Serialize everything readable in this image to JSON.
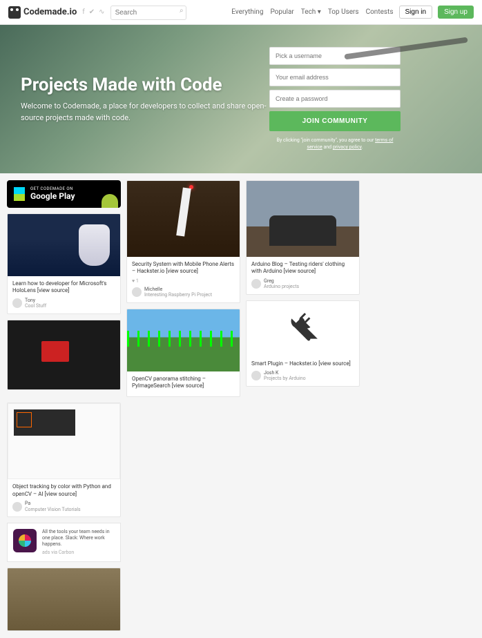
{
  "header": {
    "brand": "Codemade.io",
    "search_placeholder": "Search",
    "nav": {
      "everything": "Everything",
      "popular": "Popular",
      "tech": "Tech",
      "topusers": "Top Users",
      "contests": "Contests"
    },
    "signin": "Sign in",
    "signup": "Sign up"
  },
  "hero": {
    "title": "Projects Made with Code",
    "subtitle": "Welcome to Codemade, a place for developers to collect and share open-source projects made with code.",
    "form": {
      "username_ph": "Pick a username",
      "email_ph": "Your email address",
      "password_ph": "Create a password",
      "join": "JOIN COMMUNITY",
      "tos_pre": "By clicking \"join community\", you agree to our ",
      "tos_link1": "terms of service",
      "tos_and": " and ",
      "tos_link2": "privacy policy",
      "tos_post": "."
    }
  },
  "gplay": {
    "top": "GET CODEMADE ON",
    "bottom": "Google Play"
  },
  "cards": {
    "holo": {
      "title": "Learn how to developer for Microsoft's HoloLens [view source]",
      "user": "Tony",
      "cat": "Cool Stuff"
    },
    "security": {
      "title": "Security System with Mobile Phone Alerts – Hackster.io [view source]",
      "likes": "1",
      "user": "Michelle",
      "cat": "Interesting Raspberry Pi Project"
    },
    "pano": {
      "title": "OpenCV panorama stitching – PyImageSearch [view source]"
    },
    "moto": {
      "title": "Arduino Blog – Testing riders' clothing with Arduino [view source]",
      "user": "Greg",
      "cat": "Arduino projects"
    },
    "wrench": {
      "title": "Smart Plugin – Hackster.io [view source]",
      "user": "Josh K",
      "cat": "Projects by Arduino"
    },
    "track": {
      "title": "Object tracking by color with Python and openCV – AI [view source]",
      "user": "Pa",
      "cat": "Computer Vision Tutorials"
    }
  },
  "slack": {
    "line1": "All the tools your team needs in one place. Slack: Where work happens.",
    "ads": "ads via Carbon",
    "brand": "slack"
  }
}
